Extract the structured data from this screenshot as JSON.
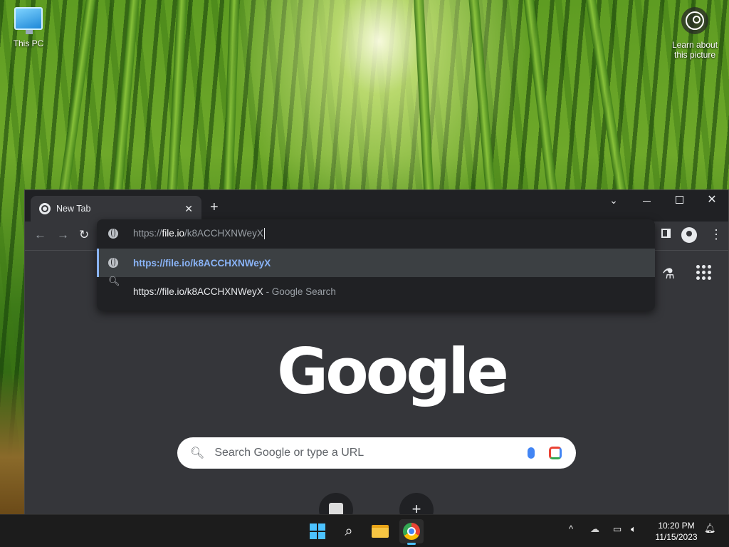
{
  "desktop": {
    "icons": [
      {
        "label": "This PC"
      },
      {
        "label": "Learn about this picture"
      }
    ]
  },
  "browser": {
    "tab": {
      "title": "New Tab",
      "close": "✕"
    },
    "new_tab": "+",
    "window_controls": {
      "tab_search": "⌄",
      "close": "✕"
    },
    "nav": {
      "back": "←",
      "forward": "→",
      "reload": "↻"
    },
    "toolbar_menu": "⋮",
    "omnibox": {
      "scheme": "https://",
      "host": "file.io",
      "path": "/k8ACCHXNWeyX",
      "suggestions": [
        {
          "text": "https://file.io/k8ACCHXNWeyX",
          "type": "url"
        },
        {
          "text": "https://file.io/k8ACCHXNWeyX",
          "suffix": " - Google Search",
          "type": "search"
        }
      ]
    },
    "ntp": {
      "logo": "Google",
      "search_placeholder": "Search Google or type a URL",
      "add_shortcut": "+"
    }
  },
  "taskbar": {
    "clock_time": "10:20 PM",
    "clock_date": "11/15/2023",
    "tray_chevron": "^"
  }
}
